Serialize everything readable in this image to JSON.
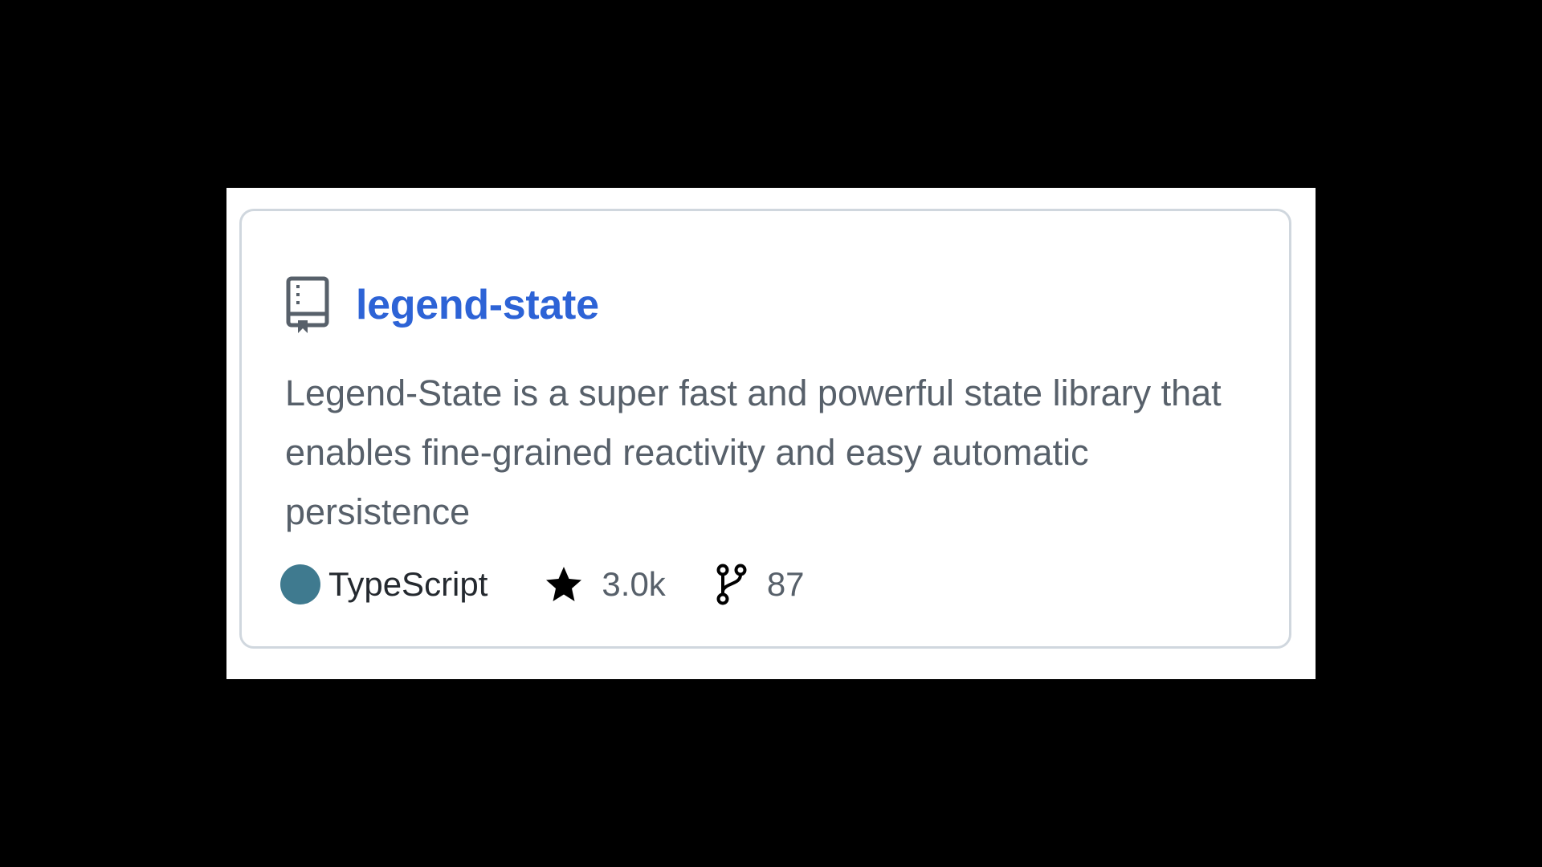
{
  "repo": {
    "name": "legend-state",
    "description": "Legend-State is a super fast and powerful state library that enables fine-grained reactivity and easy automatic persistence",
    "language": "TypeScript",
    "language_color": "#3f7a8f",
    "stars": "3.0k",
    "forks": "87",
    "icons": {
      "repo": "book-icon",
      "stars": "star-icon",
      "forks": "git-fork-icon"
    }
  },
  "colors": {
    "link": "#2d63d6",
    "muted_text": "#57606a",
    "border": "#d0d7de",
    "backdrop": "#000000"
  }
}
